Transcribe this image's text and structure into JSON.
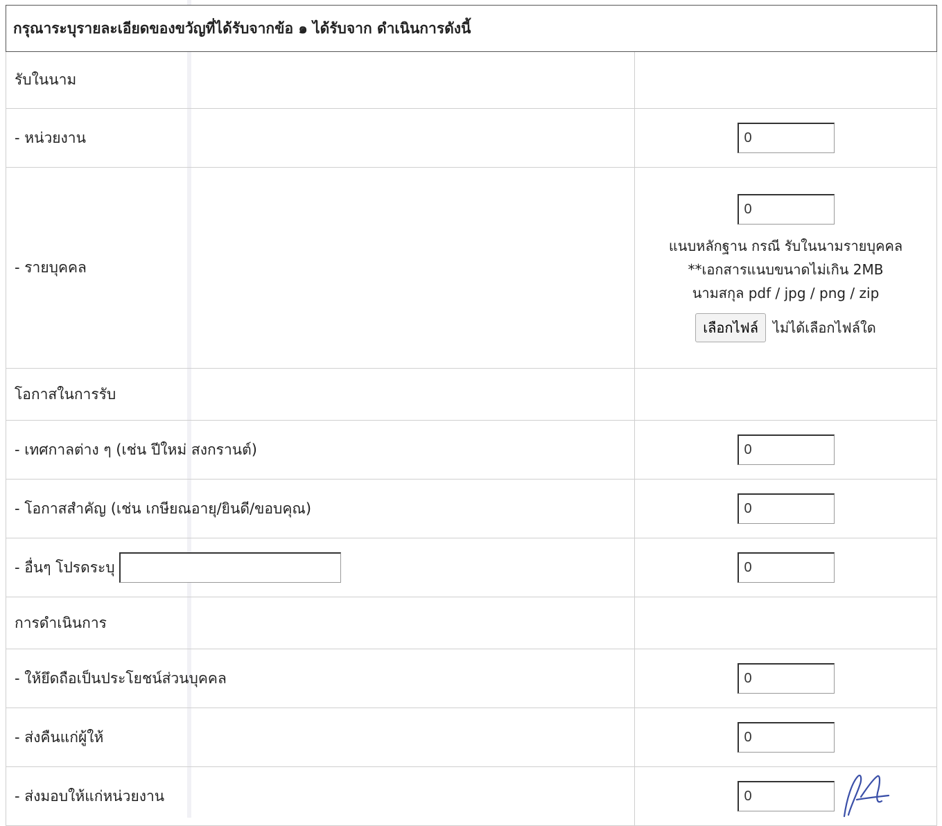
{
  "header": {
    "title": "กรุณาระบุรายละเอียดของขวัญที่ได้รับจากข้อ ๑ ได้รับจาก ดำเนินการดังนี้"
  },
  "rows": [
    {
      "label": "รับในนาม"
    },
    {
      "label": "- หน่วยงาน",
      "value": "0"
    },
    {
      "label": "- รายบุคคล",
      "value": "0",
      "note1": "แนบหลักฐาน กรณี รับในนามรายบุคคล",
      "note2": "**เอกสารแนบขนาดไม่เกิน 2MB",
      "note3": "นามสกุล pdf / jpg / png / zip",
      "file_button": "เลือกไฟล์",
      "file_status": "ไม่ได้เลือกไฟล์ใด"
    },
    {
      "label": "โอกาสในการรับ"
    },
    {
      "label": "- เทศกาลต่าง ๆ (เช่น ปีใหม่ สงกรานต์)",
      "value": "0"
    },
    {
      "label": "- โอกาสสำคัญ (เช่น เกษียณอายุ/ยินดี/ขอบคุณ)",
      "value": "0"
    },
    {
      "label": "- อื่นๆ โปรดระบุ",
      "value": "0",
      "other_text": ""
    },
    {
      "label": "การดำเนินการ"
    },
    {
      "label": "- ให้ยึดถือเป็นประโยชน์ส่วนบุคคล",
      "value": "0"
    },
    {
      "label": "- ส่งคืนแก่ผู้ให้",
      "value": "0"
    },
    {
      "label": "- ส่งมอบให้แก่หน่วยงาน",
      "value": "0"
    }
  ]
}
